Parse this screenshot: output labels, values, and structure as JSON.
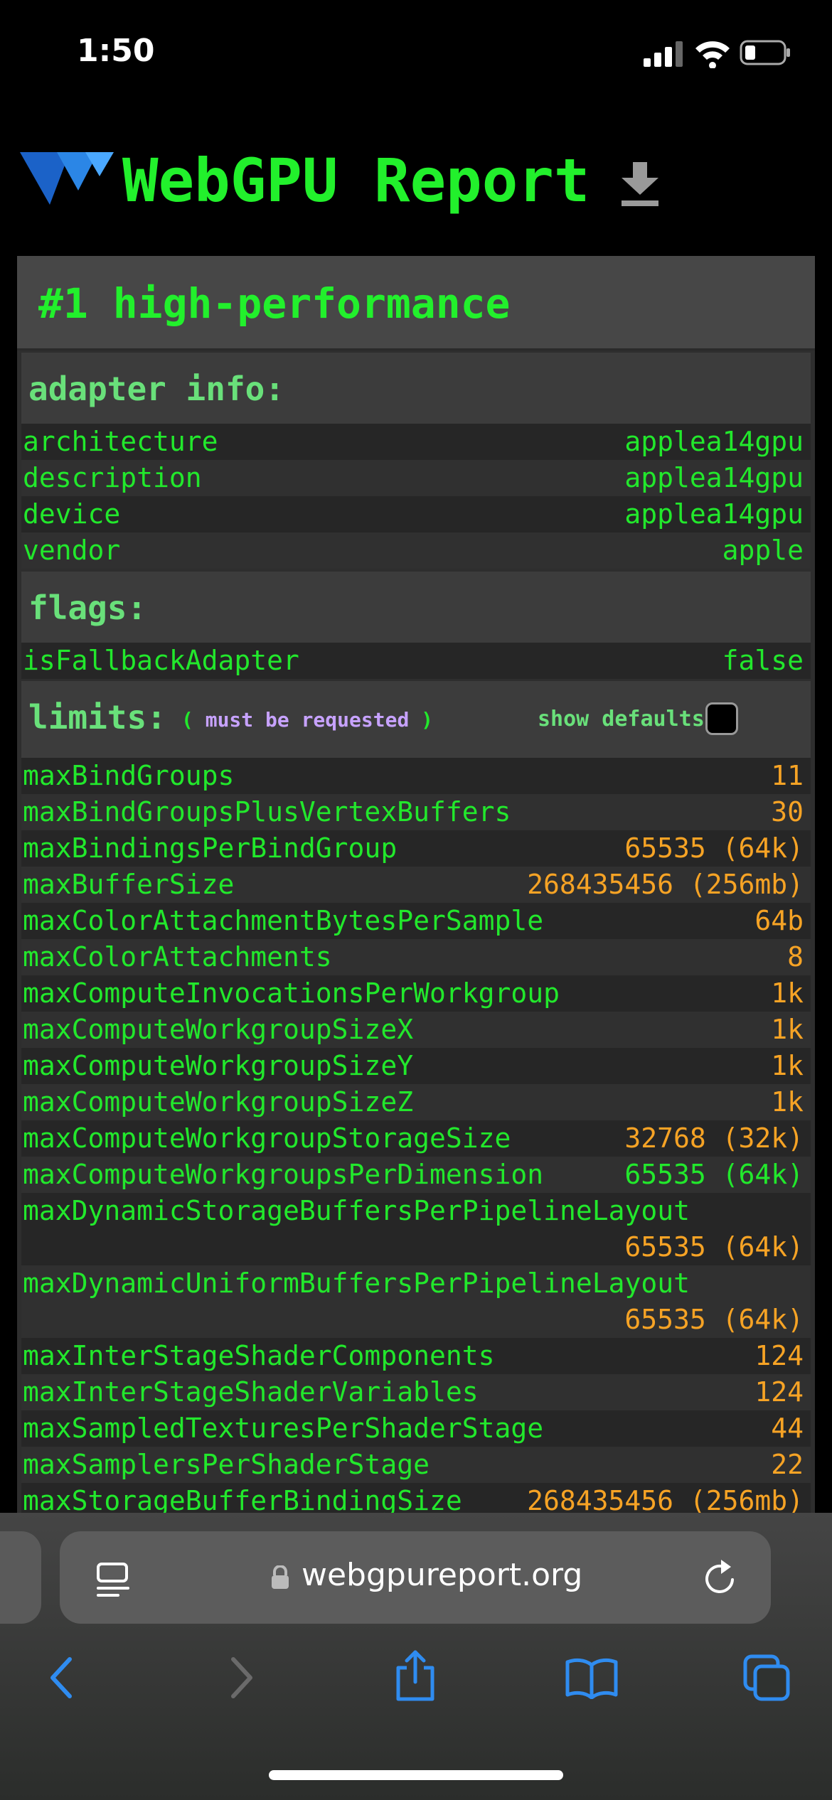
{
  "status": {
    "time": "1:50"
  },
  "header": {
    "title": "WebGPU Report"
  },
  "card": {
    "title": "#1 high-performance"
  },
  "adapter_info": {
    "heading": "adapter info:",
    "rows": [
      {
        "k": "architecture",
        "v": "applea14gpu"
      },
      {
        "k": "description",
        "v": "applea14gpu"
      },
      {
        "k": "device",
        "v": "applea14gpu"
      },
      {
        "k": "vendor",
        "v": "apple"
      }
    ]
  },
  "flags": {
    "heading": "flags:",
    "rows": [
      {
        "k": "isFallbackAdapter",
        "v": "false"
      }
    ]
  },
  "limits": {
    "heading": "limits:",
    "note_open": "(",
    "note_text": "must be requested",
    "note_close": ")",
    "show_defaults": "show defaults",
    "rows": [
      {
        "k": "maxBindGroups",
        "v": "11"
      },
      {
        "k": "maxBindGroupsPlusVertexBuffers",
        "v": "30"
      },
      {
        "k": "maxBindingsPerBindGroup",
        "v": "65535 (64k)"
      },
      {
        "k": "maxBufferSize",
        "v": "268435456 (256mb)"
      },
      {
        "k": "maxColorAttachmentBytesPerSample",
        "v": "64b"
      },
      {
        "k": "maxColorAttachments",
        "v": "8"
      },
      {
        "k": "maxComputeInvocationsPerWorkgroup",
        "v": "1k"
      },
      {
        "k": "maxComputeWorkgroupSizeX",
        "v": "1k"
      },
      {
        "k": "maxComputeWorkgroupSizeY",
        "v": "1k"
      },
      {
        "k": "maxComputeWorkgroupSizeZ",
        "v": "1k"
      },
      {
        "k": "maxComputeWorkgroupStorageSize",
        "v": "32768 (32k)"
      },
      {
        "k": "maxComputeWorkgroupsPerDimension",
        "v": "65535 (64k)"
      },
      {
        "k": "maxDynamicStorageBuffersPerPipelineLayout",
        "v": "65535 (64k)"
      },
      {
        "k": "maxDynamicUniformBuffersPerPipelineLayout",
        "v": "65535 (64k)"
      },
      {
        "k": "maxInterStageShaderComponents",
        "v": "124"
      },
      {
        "k": "maxInterStageShaderVariables",
        "v": "124"
      },
      {
        "k": "maxSampledTexturesPerShaderStage",
        "v": "44"
      },
      {
        "k": "maxSamplersPerShaderStage",
        "v": "22"
      },
      {
        "k": "maxStorageBufferBindingSize",
        "v": "268435456 (256mb)"
      }
    ]
  },
  "browser": {
    "url": "webgpureport.org"
  },
  "colors": {
    "accent_green": "#22e82c",
    "value_orange": "#f6a325",
    "note_purple": "#c7a2ff",
    "safari_blue": "#2f8cf0"
  }
}
